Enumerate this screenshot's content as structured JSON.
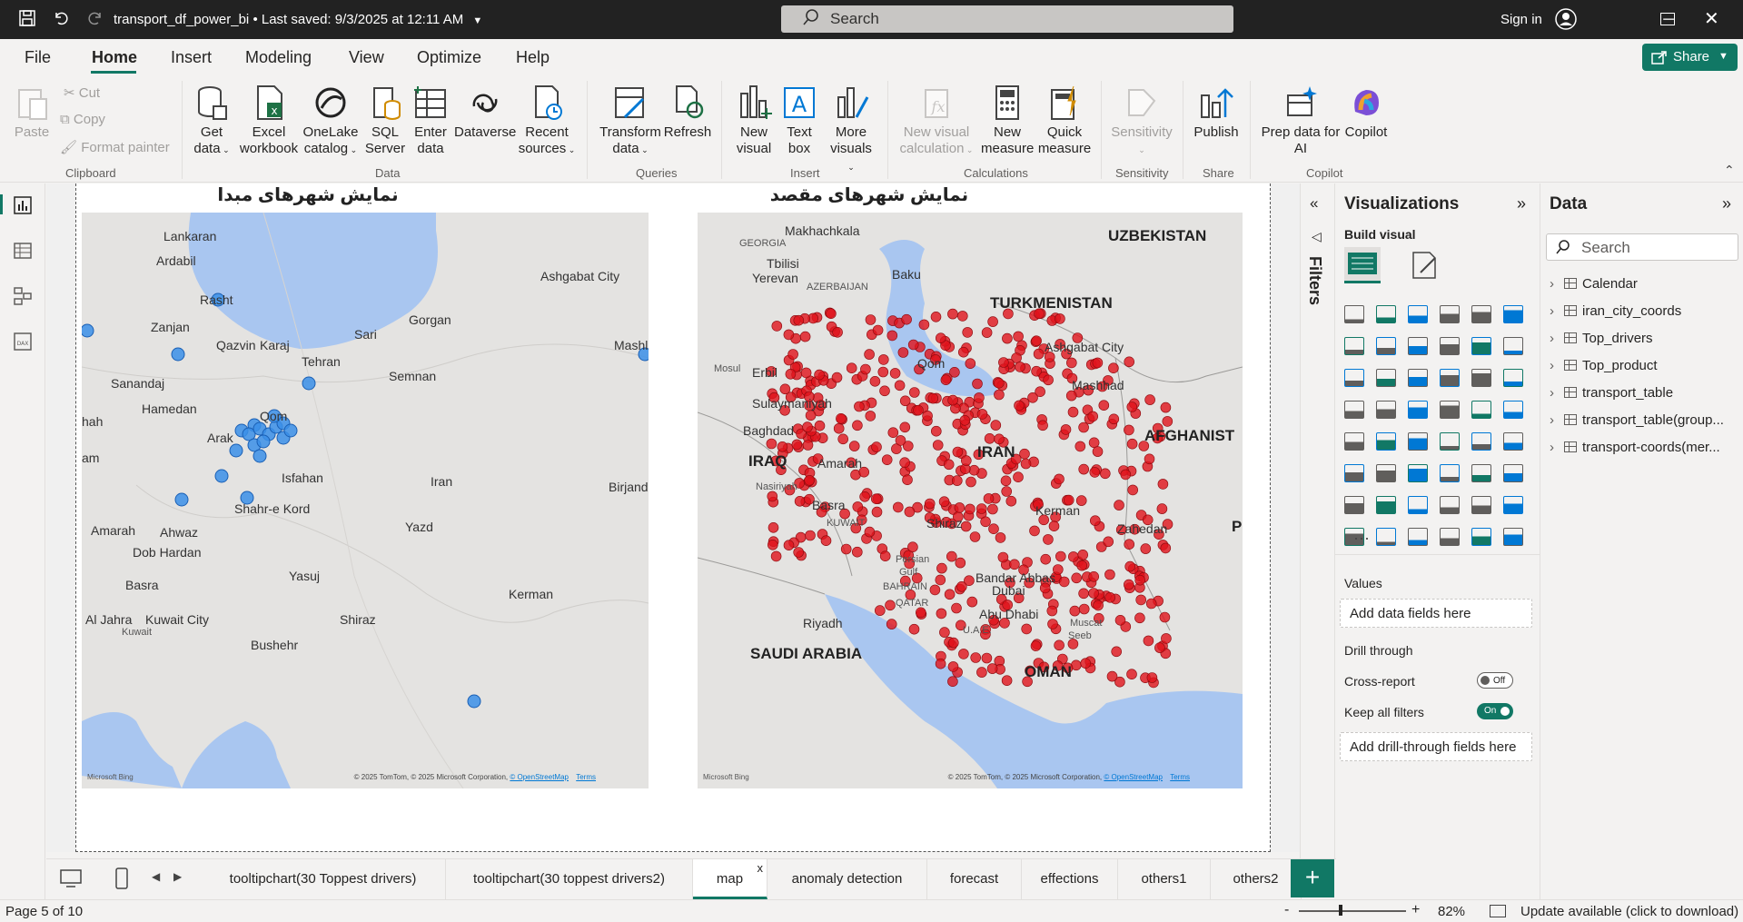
{
  "titlebar": {
    "document": "transport_df_power_bi",
    "saved": "Last saved: 9/3/2025 at 12:11 AM",
    "search": "Search",
    "signin": "Sign in"
  },
  "menu": {
    "items": [
      "File",
      "Home",
      "Insert",
      "Modeling",
      "View",
      "Optimize",
      "Help"
    ],
    "active": "Home",
    "share": "Share"
  },
  "ribbon": {
    "clipboard": {
      "paste": "Paste",
      "cut": "Cut",
      "copy": "Copy",
      "format_painter": "Format painter",
      "group": "Clipboard"
    },
    "data": {
      "get_data": [
        "Get",
        "data"
      ],
      "excel": [
        "Excel",
        "workbook"
      ],
      "onelake": [
        "OneLake",
        "catalog"
      ],
      "sql": [
        "SQL",
        "Server"
      ],
      "enter": [
        "Enter",
        "data"
      ],
      "dataverse": "Dataverse",
      "recent": [
        "Recent",
        "sources"
      ],
      "group": "Data"
    },
    "queries": {
      "transform": [
        "Transform",
        "data"
      ],
      "refresh": "Refresh",
      "group": "Queries"
    },
    "insert": {
      "new_visual": [
        "New",
        "visual"
      ],
      "text_box": [
        "Text",
        "box"
      ],
      "more_visuals": [
        "More",
        "visuals"
      ],
      "group": "Insert"
    },
    "calculations": {
      "new_calc": [
        "New visual",
        "calculation"
      ],
      "new_measure": [
        "New",
        "measure"
      ],
      "quick_measure": [
        "Quick",
        "measure"
      ],
      "group": "Calculations"
    },
    "sensitivity": {
      "label": "Sensitivity",
      "group": "Sensitivity"
    },
    "share": {
      "publish": "Publish",
      "group": "Share"
    },
    "copilot": {
      "prep": [
        "Prep data for",
        "AI"
      ],
      "copilot": "Copilot",
      "group": "Copilot"
    }
  },
  "visuals": {
    "left_title": "نمایش شهرهای مبدا",
    "right_title": "نمایش شهرهای مقصد",
    "attribution": "© 2025 TomTom, © 2025 Microsoft Corporation,",
    "osm": "© OpenStreetMap",
    "terms": "Terms",
    "bing": "Microsoft Bing",
    "left_labels": [
      "Lankaran",
      "Ardabil",
      "Rasht",
      "Ashgabat City",
      "Gorgan",
      "Zanjan",
      "Qazvin",
      "Karaj",
      "Sari",
      "Tehran",
      "Mashl",
      "Sanandaj",
      "Semnan",
      "Hamedan",
      "hah",
      "Qom",
      "Arak",
      "Isfahan",
      "Iran",
      "Birjand",
      "am",
      "Shahr-e Kord",
      "Yazd",
      "Amarah",
      "Ahwaz",
      "Dob Hardan",
      "Yasuj",
      "Basra",
      "Kerman",
      "Al Jahra",
      "Kuwait City",
      "Shiraz",
      "Kuwait",
      "Bushehr"
    ],
    "right_labels": [
      "Makhachkala",
      "UZBEKISTAN",
      "GEORGIA",
      "Tbilisi",
      "AZERBAIJAN",
      "Baku",
      "Yerevan",
      "TURKMENISTAN",
      "Ashgabat City",
      "Mosul",
      "Erbil",
      "Sulaymaniyah",
      "Qom",
      "Mashhad",
      "Baghdad",
      "IRAN",
      "AFGHANIST",
      "IRAQ",
      "Amarah",
      "Nasiriyah",
      "Kerman",
      "Basra",
      "Zahedan",
      "KUWAIT",
      "Persian",
      "Gulf",
      "Shiraz",
      "BAHRAIN",
      "Bandar Abbas",
      "QATAR",
      "Dubai",
      "Abu Dhabi",
      "Riyadh",
      "Muscat",
      "U.A.E.",
      "Seeb",
      "SAUDI ARABIA",
      "OMAN",
      "P"
    ]
  },
  "filters": {
    "label": "Filters"
  },
  "viz_pane": {
    "title": "Visualizations",
    "build": "Build visual",
    "values": "Values",
    "add_fields": "Add data fields here",
    "drill": "Drill through",
    "cross_report": "Cross-report",
    "cross_state": "Off",
    "keep_filters": "Keep all filters",
    "keep_state": "On",
    "add_drill": "Add drill-through fields here",
    "more": "···"
  },
  "data_pane": {
    "title": "Data",
    "search": "Search",
    "tables": [
      "Calendar",
      "iran_city_coords",
      "Top_drivers",
      "Top_product",
      "transport_table",
      "transport_table(group...",
      "transport-coords(mer..."
    ]
  },
  "tabs": {
    "items": [
      "tooltipchart(30 Toppest drivers)",
      "tooltipchart(30 toppest drivers2)",
      "map",
      "anomaly detection",
      "forecast",
      "effections",
      "others1",
      "others2"
    ],
    "active": "map",
    "close": "x"
  },
  "status": {
    "page": "Page 5 of 10",
    "zoom": "82%",
    "update": "Update available (click to download)",
    "minus": "-",
    "plus": "+"
  },
  "colors": {
    "accent": "#117865",
    "origin_dots": "#3b8fe8",
    "dest_dots": "#e0131b",
    "water": "#a9c6f0"
  }
}
